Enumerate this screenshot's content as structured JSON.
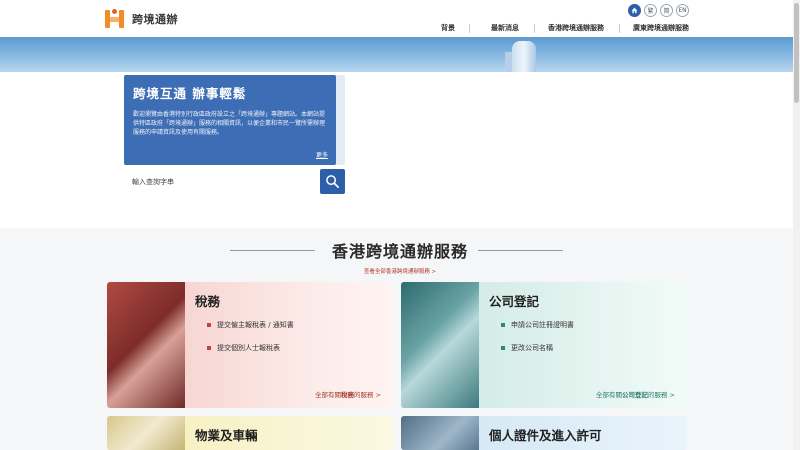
{
  "header": {
    "logo_text": "跨境通辦",
    "lang_icons": [
      "home-icon",
      "繁",
      "简",
      "EN"
    ],
    "nav": [
      "背景",
      "最新消息",
      "香港跨境通辦服務",
      "廣東跨境通辦服務"
    ]
  },
  "intro": {
    "title": "跨境互通 辦事輕鬆",
    "body": "歡迎瀏覽由香港特別行政區政府設立之「跨境通辦」專題網站。本網站提供特區政府「跨境通辦」服務的相關資訊，以便企業和市民一覽所需辦理服務的申請資訊及使用有關服務。",
    "more": "更多"
  },
  "search": {
    "placeholder": "輸入查詢字串"
  },
  "section": {
    "title": "香港跨境通辦服務",
    "link": "查看全部香港跨境通辦服務 >"
  },
  "cards": [
    {
      "title": "稅務",
      "items": [
        "提交僱主報稅表 / 通知書",
        "提交個別人士報稅表"
      ],
      "more_prefix": "全部有關",
      "more_key": "稅務",
      "more_suffix": "的服務 >"
    },
    {
      "title": "公司登記",
      "items": [
        "申請公司註冊證明書",
        "更改公司名稱"
      ],
      "more_prefix": "全部有關",
      "more_key": "公司登記",
      "more_suffix": "的服務 >"
    },
    {
      "title": "物業及車輛"
    },
    {
      "title": "個人證件及進入許可"
    }
  ]
}
